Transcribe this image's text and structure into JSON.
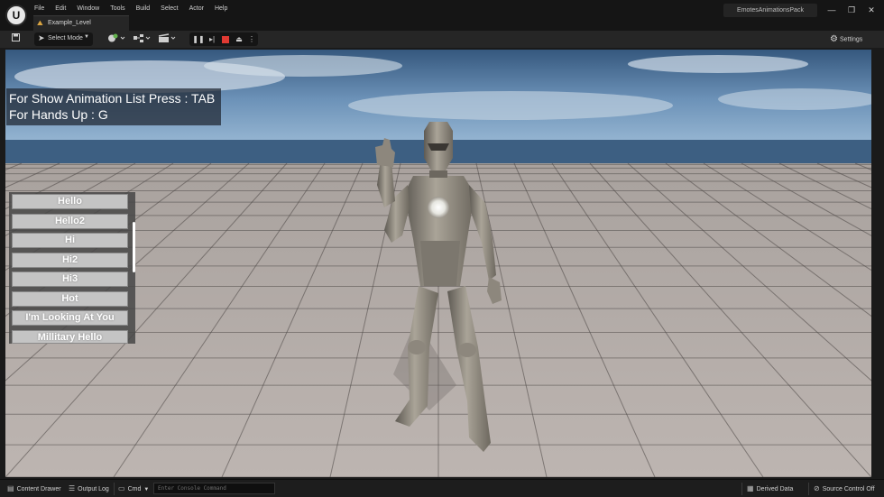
{
  "app": {
    "logo": "unreal-engine-logo",
    "menu": [
      "File",
      "Edit",
      "Window",
      "Tools",
      "Build",
      "Select",
      "Actor",
      "Help"
    ],
    "level_tab": "Example_Level",
    "project_name": "EmotesAnimationsPack",
    "window_controls": {
      "minimize": "—",
      "restore": "❐",
      "close": "✕"
    }
  },
  "toolbar": {
    "save_icon": "save-icon",
    "select_mode_label": "Select Mode",
    "add_actor_icon": "add-actor-icon",
    "blueprint_icon": "blueprint-icon",
    "cinematics_icon": "cinematics-icon",
    "play_controls": [
      "pause",
      "frame-skip",
      "stop",
      "eject",
      "more-options"
    ],
    "settings_label": "Settings"
  },
  "viewport": {
    "hud_lines": [
      "For Show Animation List Press : TAB",
      "For Hands Up : G"
    ],
    "animation_list": [
      "Hello",
      "Hello2",
      "Hi",
      "Hi2",
      "Hi3",
      "Hot",
      "I'm Looking At You",
      "Millitary Hello"
    ],
    "colors": {
      "sky_top": "#35587e",
      "sky_bottom": "#8fb1cf",
      "horizon_sea": "#3d5f82",
      "floor": "#b7aea9",
      "floor_tile_alt": "#c7c0bc",
      "character": "#8d877d"
    }
  },
  "statusbar": {
    "content_drawer": "Content Drawer",
    "output_log": "Output Log",
    "cmd": "Cmd",
    "console_placeholder": "Enter Console Command",
    "derived_data": "Derived Data",
    "source_control": "Source Control Off"
  }
}
